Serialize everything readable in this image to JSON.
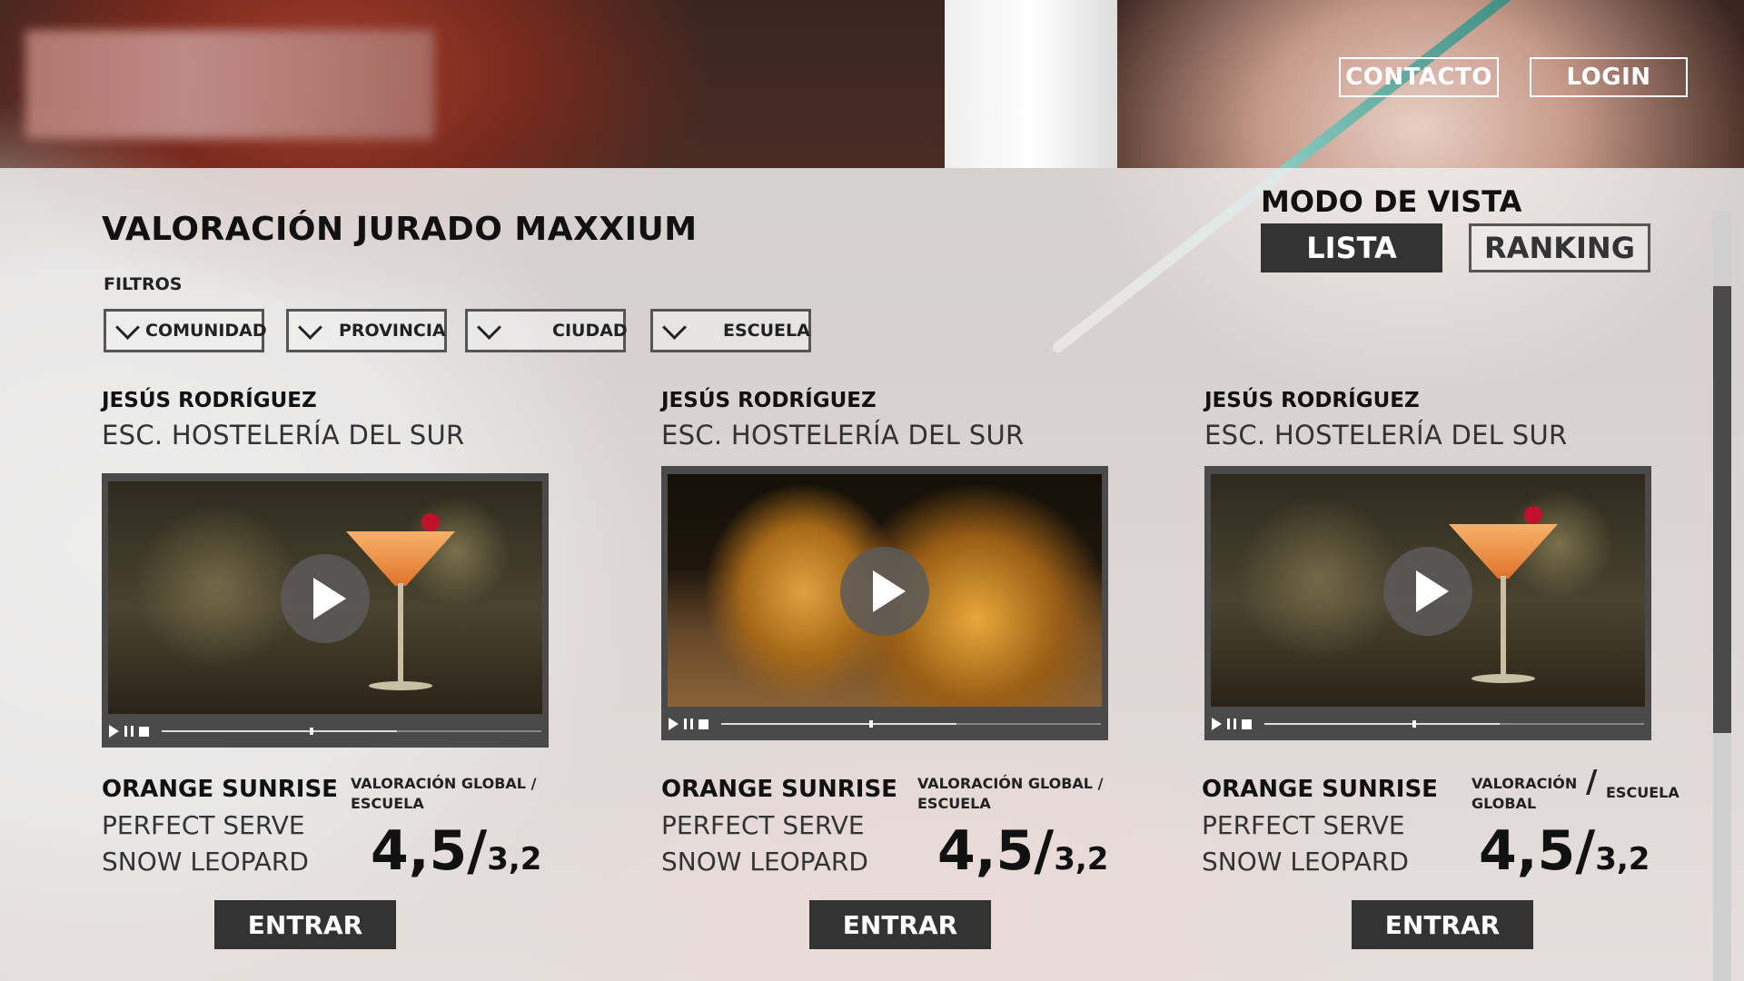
{
  "header": {
    "contact_label": "CONTACTO",
    "login_label": "LOGIN"
  },
  "main": {
    "title": "VALORACIÓN JURADO MAXXIUM",
    "filters_label": "FILTROS",
    "filters": [
      "COMUNIDAD",
      "PROVINCIA",
      "CIUDAD",
      "ESCUELA"
    ],
    "view_mode": {
      "label": "MODO DE VISTA",
      "options": [
        "LISTA",
        "RANKING"
      ],
      "selected": "LISTA"
    }
  },
  "cards": [
    {
      "name": "JESÚS RODRÍGUEZ",
      "school": "ESC. HOSTELERÍA DEL SUR",
      "video_progress": 0.39,
      "video_buffered": 0.62,
      "drink": "ORANGE SUNRISE",
      "line1": "PERFECT SERVE",
      "line2": "SNOW LEOPARD",
      "rating_label_a": "VALORACIÓN GLOBAL /",
      "rating_label_b": "ESCUELA",
      "score_global": "4,5/",
      "score_school": "3,2",
      "enter_label": "ENTRAR"
    },
    {
      "name": "JESÚS RODRÍGUEZ",
      "school": "ESC. HOSTELERÍA DEL SUR",
      "video_progress": 0.39,
      "video_buffered": 0.62,
      "drink": "ORANGE SUNRISE",
      "line1": "PERFECT SERVE",
      "line2": "SNOW LEOPARD",
      "rating_label_a": "VALORACIÓN GLOBAL /",
      "rating_label_b": "ESCUELA",
      "score_global": "4,5/",
      "score_school": "3,2",
      "enter_label": "ENTRAR"
    },
    {
      "name": "JESÚS RODRÍGUEZ",
      "school": "ESC. HOSTELERÍA DEL SUR",
      "video_progress": 0.39,
      "video_buffered": 0.62,
      "drink": "ORANGE SUNRISE",
      "line1": "PERFECT SERVE",
      "line2": "SNOW LEOPARD",
      "rating_label_a": "VALORACIÓN GLOBAL",
      "rating_label_slash": "/",
      "rating_label_b": "ESCUELA",
      "score_global": "4,5/",
      "score_school": "3,2",
      "enter_label": "ENTRAR"
    }
  ],
  "colors": {
    "dark_button": "#333333",
    "panel_overlay": "#ececec",
    "header_button_border": "#ffffff"
  },
  "icons": [
    "play-icon",
    "pause-icon",
    "stop-icon",
    "chevron-down-icon"
  ]
}
